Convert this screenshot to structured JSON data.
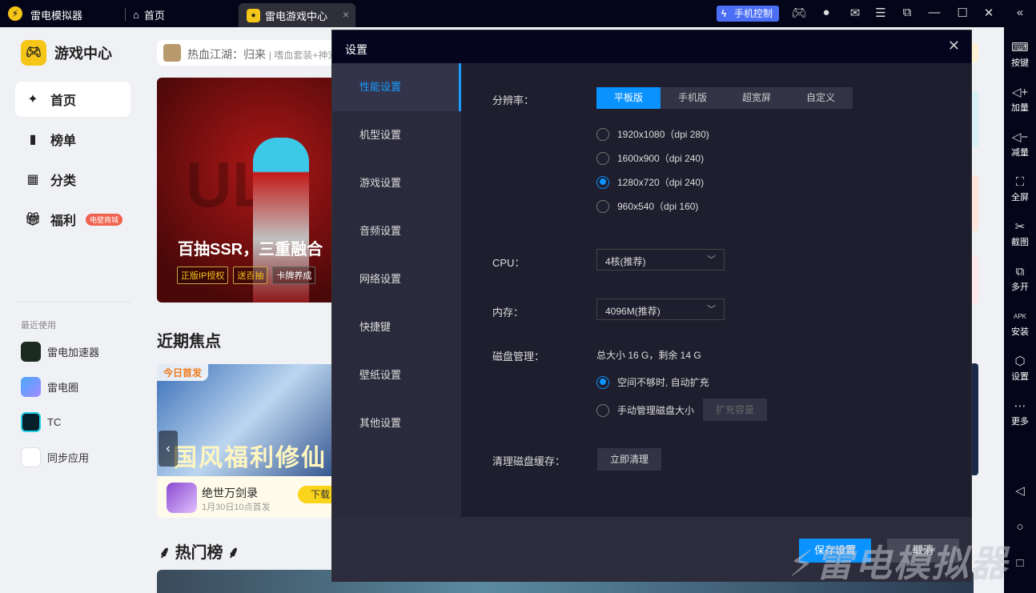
{
  "titlebar": {
    "app_name": "雷电模拟器",
    "home_tab": "首页",
    "active_tab": "雷电游戏中心",
    "phone_control": "手机控制"
  },
  "sidebar": {
    "brand": "游戏中心",
    "items": [
      {
        "label": "首页"
      },
      {
        "label": "榜单"
      },
      {
        "label": "分类"
      },
      {
        "label": "福利",
        "badge": "电壁商城"
      }
    ],
    "recent_title": "最近使用",
    "recent": [
      {
        "label": "雷电加速器"
      },
      {
        "label": "雷电圈"
      },
      {
        "label": "TC"
      },
      {
        "label": "同步应用"
      }
    ]
  },
  "main": {
    "search_title": "热血江湖：归来",
    "search_sub": "嗜血套装+神宠",
    "banner": {
      "headline": "百抽SSR，三重融合",
      "tags": [
        "正版IP授权",
        "送百抽",
        "卡牌养成"
      ]
    },
    "focus_title": "近期焦点",
    "focus_card": {
      "tag": "今日首发",
      "art_text": "国风福利修仙",
      "game": "绝世万剑录",
      "date": "1月30日10点首发",
      "download": "下载"
    },
    "hot_title": "热门榜"
  },
  "rightbar": [
    "按键",
    "加量",
    "减量",
    "全屏",
    "截图",
    "多开",
    "安装",
    "设置",
    "更多"
  ],
  "dialog": {
    "title": "设置",
    "nav": [
      "性能设置",
      "机型设置",
      "游戏设置",
      "音频设置",
      "网络设置",
      "快捷键",
      "壁纸设置",
      "其他设置"
    ],
    "resolution_label": "分辨率：",
    "res_tabs": [
      "平板版",
      "手机版",
      "超宽屏",
      "自定义"
    ],
    "resolutions": [
      "1920x1080（dpi 280)",
      "1600x900（dpi 240)",
      "1280x720（dpi 240)",
      "960x540（dpi 160)"
    ],
    "selected_resolution": 2,
    "cpu_label": "CPU：",
    "cpu_value": "4核(推荐)",
    "memory_label": "内存：",
    "memory_value": "4096M(推荐)",
    "disk_label": "磁盘管理：",
    "disk_info": "总大小 16 G，剩余 14 G",
    "disk_auto": "空间不够时, 自动扩充",
    "disk_manual": "手动管理磁盘大小",
    "expand": "扩充容量",
    "cache_label": "清理磁盘缓存：",
    "clean_now": "立即清理",
    "save": "保存设置",
    "cancel": "取消"
  },
  "watermark": "雷电模拟器",
  "colors": {
    "accent": "#0a92ff",
    "brand": "#f5c518"
  }
}
